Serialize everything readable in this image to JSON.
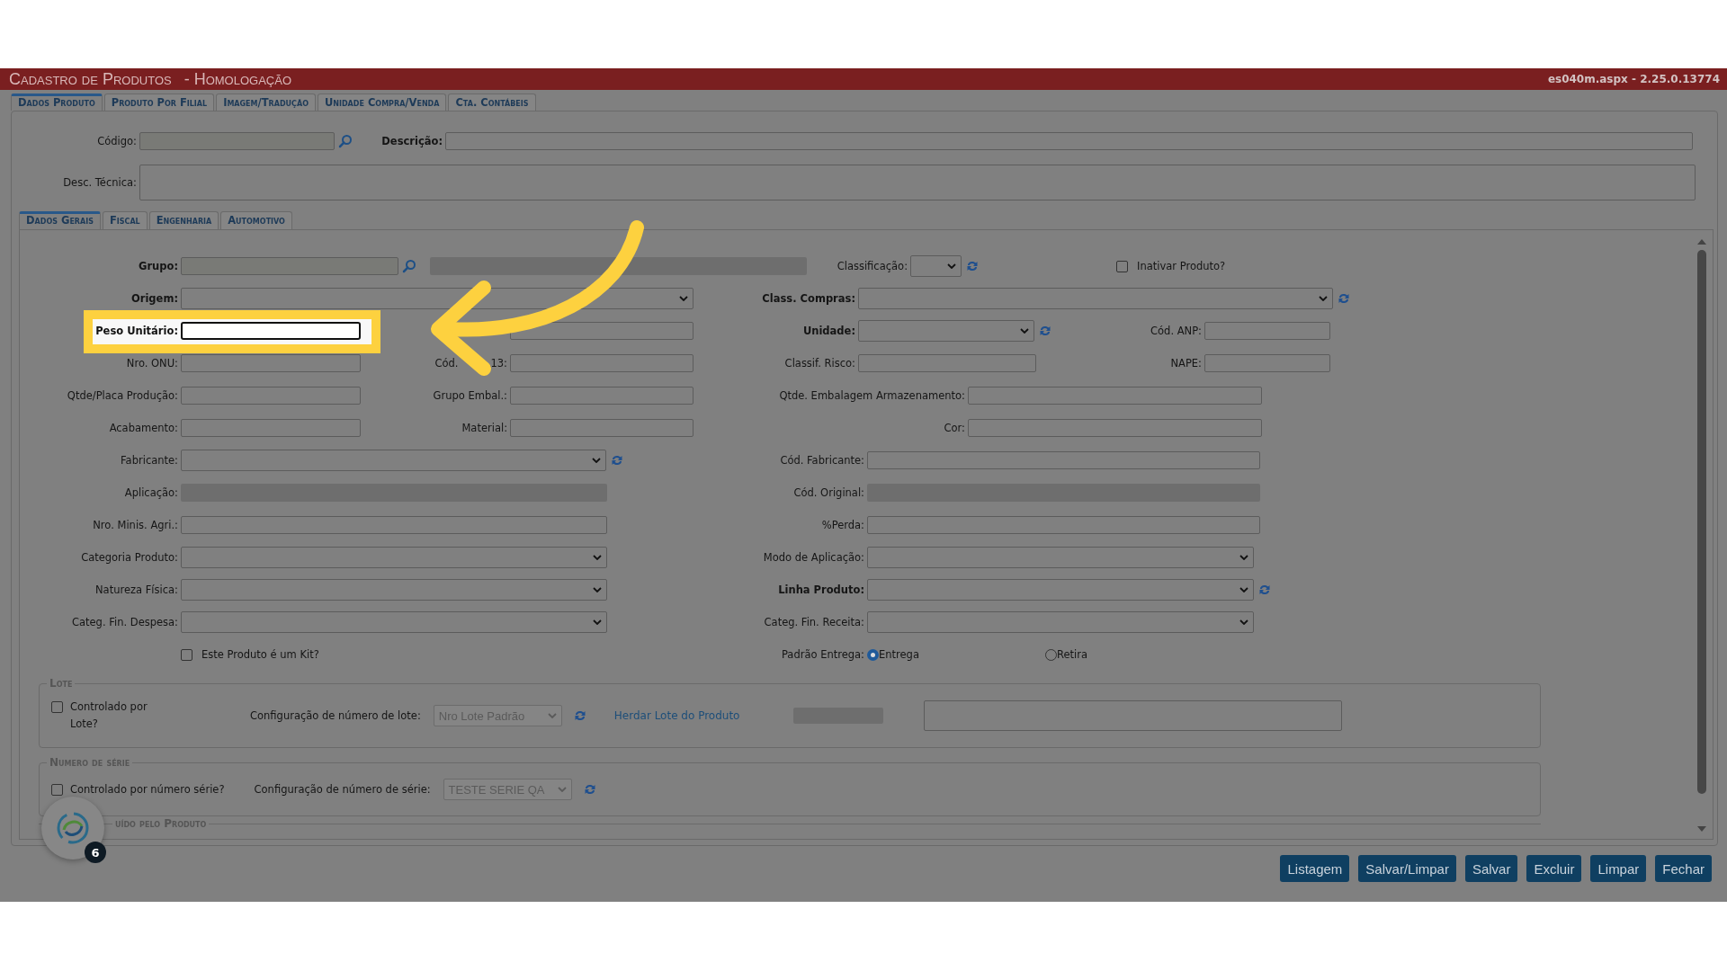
{
  "header": {
    "title": "Cadastro de Produtos",
    "subtitle": "- Homologação",
    "version": "es040m.aspx - 2.25.0.13774"
  },
  "tabs": [
    {
      "label": "Dados Produto",
      "selected": true
    },
    {
      "label": "Produto Por Filial",
      "selected": false
    },
    {
      "label": "Imagem/Tradução",
      "selected": false
    },
    {
      "label": "Unidade Compra/Venda",
      "selected": false
    },
    {
      "label": "Cta. Contábeis",
      "selected": false
    }
  ],
  "codigo": {
    "label": "Código:"
  },
  "descricao": {
    "label": "Descrição:"
  },
  "desc_tecnica": {
    "label": "Desc. Técnica:"
  },
  "subtabs": [
    {
      "label": "Dados Gerais",
      "selected": true
    },
    {
      "label": "Fiscal",
      "selected": false
    },
    {
      "label": "Engenharia",
      "selected": false
    },
    {
      "label": "Automotivo",
      "selected": false
    }
  ],
  "rows": [
    {
      "items": [
        {
          "kind": "lookup",
          "label": "Grupo:",
          "bold": true
        },
        {
          "kind": "readonly"
        },
        {
          "kind": "select",
          "label": "Classificação:",
          "refresh": true
        },
        {
          "kind": "checkbox",
          "label": "Inativar Produto?",
          "checked": false
        }
      ]
    },
    {
      "items": [
        {
          "kind": "select",
          "label": "Origem:",
          "bold": true
        },
        {
          "kind": "select",
          "label": "Class. Compras:",
          "bold": true,
          "refresh": true
        }
      ]
    },
    {
      "items": [
        {
          "kind": "text",
          "label": "Peso Unitário:",
          "bold": true,
          "highlighted": true
        },
        {
          "kind": "text"
        },
        {
          "kind": "select",
          "label": "Unidade:",
          "bold": true,
          "refresh": true
        },
        {
          "kind": "text",
          "label": "Cód. ANP:"
        }
      ]
    },
    {
      "items": [
        {
          "kind": "text",
          "label": "Nro. ONU:"
        },
        {
          "kind": "text",
          "label": "Cód.",
          "label_tail": "13:"
        },
        {
          "kind": "text",
          "label": "Classif. Risco:"
        },
        {
          "kind": "text",
          "label": "NAPE:"
        }
      ]
    },
    {
      "items": [
        {
          "kind": "text",
          "label": "Qtde/Placa Produção:"
        },
        {
          "kind": "text",
          "label": "Grupo Embal.:"
        },
        {
          "kind": "text",
          "label": "Qtde. Embalagem Armazenamento:"
        }
      ]
    },
    {
      "items": [
        {
          "kind": "text",
          "label": "Acabamento:"
        },
        {
          "kind": "text",
          "label": "Material:"
        },
        {
          "kind": "text",
          "label": "Cor:"
        }
      ]
    },
    {
      "items": [
        {
          "kind": "select",
          "label": "Fabricante:",
          "refresh": true
        },
        {
          "kind": "text",
          "label": "Cód. Fabricante:"
        }
      ]
    },
    {
      "items": [
        {
          "kind": "readonly",
          "label": "Aplicação:"
        },
        {
          "kind": "readonly",
          "label": "Cód. Original:"
        }
      ]
    },
    {
      "items": [
        {
          "kind": "text",
          "label": "Nro. Minis. Agri.:"
        },
        {
          "kind": "text",
          "label": "%Perda:"
        }
      ]
    },
    {
      "items": [
        {
          "kind": "select",
          "label": "Categoria Produto:"
        },
        {
          "kind": "select",
          "label": "Modo de Aplicação:"
        }
      ]
    },
    {
      "items": [
        {
          "kind": "select",
          "label": "Natureza Física:"
        },
        {
          "kind": "select",
          "label": "Linha Produto:",
          "bold": true,
          "refresh": true
        }
      ]
    },
    {
      "items": [
        {
          "kind": "select",
          "label": "Categ. Fin. Despesa:"
        },
        {
          "kind": "select",
          "label": "Categ. Fin. Receita:"
        }
      ]
    },
    {
      "items": [
        {
          "kind": "checkbox",
          "label": "Este Produto é um Kit?",
          "checked": false
        },
        {
          "kind": "radio",
          "label": "Padrão Entrega:",
          "options": [
            {
              "label": "Entrega",
              "selected": true
            },
            {
              "label": "Retira",
              "selected": false
            }
          ]
        }
      ]
    }
  ],
  "lote": {
    "legend": "Lote",
    "checkbox": {
      "label": "Controlado por Lote?",
      "checked": false
    },
    "config_label": "Configuração de número de lote:",
    "config_value": "Nro Lote Padrão",
    "link": "Herdar Lote do Produto"
  },
  "serie": {
    "legend": "Numero de série",
    "checkbox": {
      "label": "Controlado por número série?",
      "checked": false
    },
    "config_label": "Configuração de número de série:",
    "config_value": "TESTE SERIE QA"
  },
  "third_section": {
    "legend": "uído pelo Produto"
  },
  "chat_widget": {
    "badge": "6"
  },
  "buttons": [
    "Listagem",
    "Salvar/Limpar",
    "Salvar",
    "Excluir",
    "Limpar",
    "Fechar"
  ]
}
